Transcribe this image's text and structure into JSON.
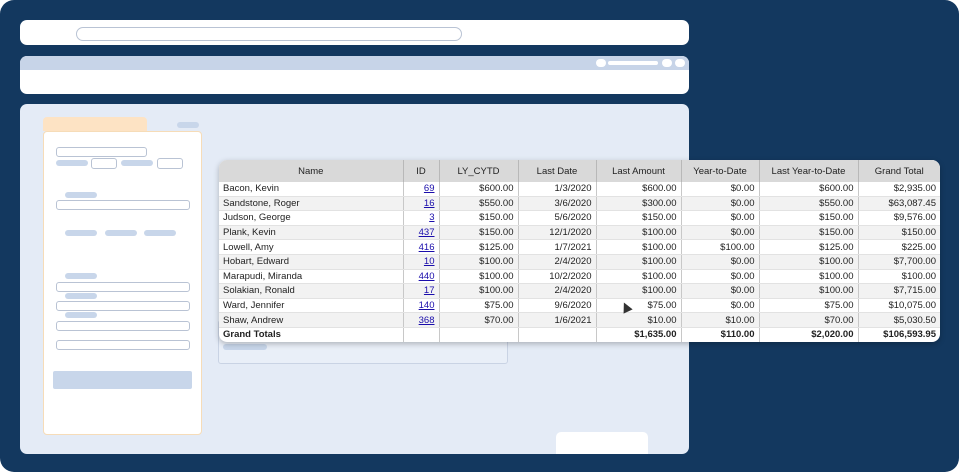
{
  "colors": {
    "frame_bg": "#13385f",
    "content_bg": "#e4ebf6",
    "header_bg": "#d9d9d9",
    "link": "#1a0dab"
  },
  "table": {
    "columns": [
      "Name",
      "ID",
      "LY_CYTD",
      "Last Date",
      "Last Amount",
      "Year-to-Date",
      "Last Year-to-Date",
      "Grand Total"
    ],
    "rows": [
      [
        "Bacon, Kevin",
        "69",
        "$600.00",
        "1/3/2020",
        "$600.00",
        "$0.00",
        "$600.00",
        "$2,935.00"
      ],
      [
        "Sandstone, Roger",
        "16",
        "$550.00",
        "3/6/2020",
        "$300.00",
        "$0.00",
        "$550.00",
        "$63,087.45"
      ],
      [
        "Judson, George",
        "3",
        "$150.00",
        "5/6/2020",
        "$150.00",
        "$0.00",
        "$150.00",
        "$9,576.00"
      ],
      [
        "Plank, Kevin",
        "437",
        "$150.00",
        "12/1/2020",
        "$100.00",
        "$0.00",
        "$150.00",
        "$150.00"
      ],
      [
        "Lowell, Amy",
        "416",
        "$125.00",
        "1/7/2021",
        "$100.00",
        "$100.00",
        "$125.00",
        "$225.00"
      ],
      [
        "Hobart, Edward",
        "10",
        "$100.00",
        "2/4/2020",
        "$100.00",
        "$0.00",
        "$100.00",
        "$7,700.00"
      ],
      [
        "Marapudi, Miranda",
        "440",
        "$100.00",
        "10/2/2020",
        "$100.00",
        "$0.00",
        "$100.00",
        "$100.00"
      ],
      [
        "Solakian, Ronald",
        "17",
        "$100.00",
        "2/4/2020",
        "$100.00",
        "$0.00",
        "$100.00",
        "$7,715.00"
      ],
      [
        "Ward, Jennifer",
        "140",
        "$75.00",
        "9/6/2020",
        "$75.00",
        "$0.00",
        "$75.00",
        "$10,075.00"
      ],
      [
        "Shaw, Andrew",
        "368",
        "$70.00",
        "1/6/2021",
        "$10.00",
        "$10.00",
        "$70.00",
        "$5,030.50"
      ]
    ],
    "totals": {
      "label": "Grand Totals",
      "last_amount": "$1,635.00",
      "ytd": "$110.00",
      "last_ytd": "$2,020.00",
      "grand_total": "$106,593.95"
    }
  }
}
